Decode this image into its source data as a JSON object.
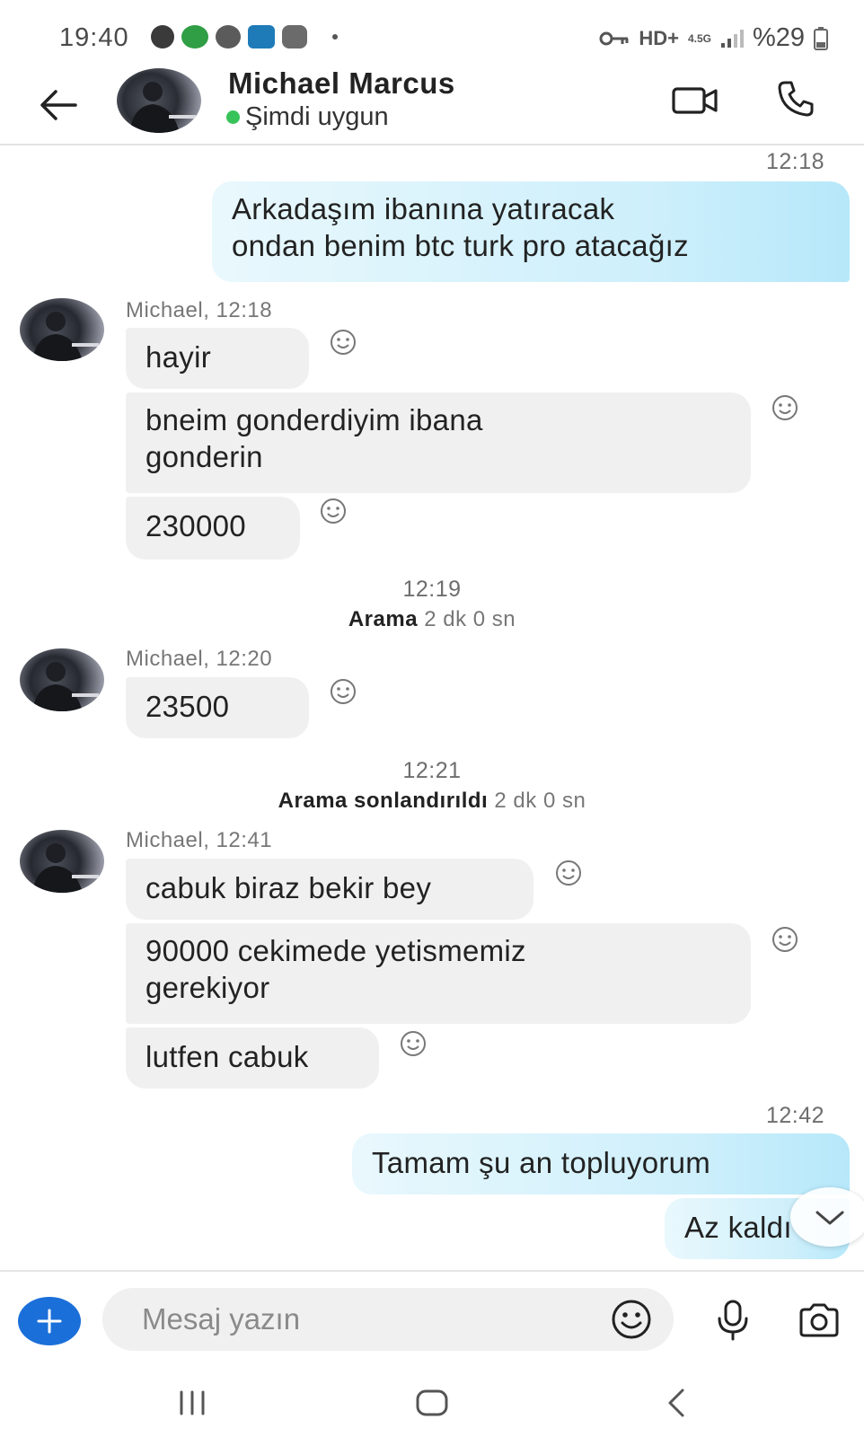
{
  "status_bar": {
    "time": "19:40",
    "network": "HD+",
    "network_gen": "4.5G",
    "battery": "%29"
  },
  "header": {
    "contact_name": "Michael Marcus",
    "presence": "Şimdi uygun"
  },
  "messages": {
    "m1_time": "12:18",
    "m1_text_line1": "Arkadaşım ibanına yatıracak",
    "m1_text_line2": "ondan benim btc turk pro atacağız",
    "g1_sender": "Michael, 12:18",
    "g1_b1": "hayir",
    "g1_b2_line1": "bneim gonderdiyim ibana",
    "g1_b2_line2": "gonderin",
    "g1_b3": "230000",
    "sys1_time": "12:19",
    "sys1_label": "Arama",
    "sys1_duration": "2 dk 0 sn",
    "g2_sender": "Michael, 12:20",
    "g2_b1": "23500",
    "sys2_time": "12:21",
    "sys2_label": "Arama sonlandırıldı",
    "sys2_duration": "2 dk 0 sn",
    "g3_sender": "Michael, 12:41",
    "g3_b1": "cabuk biraz bekir bey",
    "g3_b2_line1": "90000 cekimede yetismemiz",
    "g3_b2_line2": "gerekiyor",
    "g3_b3": "lutfen cabuk",
    "m2_time": "12:42",
    "m2_text": "Tamam şu an topluyorum",
    "m3_text": "Az kaldı"
  },
  "compose": {
    "placeholder": "Mesaj yazın"
  },
  "colors": {
    "outgoing_bubble": "#cdeffb",
    "incoming_bubble": "#f0f0f0",
    "accent": "#1b6fd9",
    "online": "#38c35a"
  },
  "icons": [
    "back-arrow-icon",
    "video-call-icon",
    "phone-icon",
    "smiley-react-icon",
    "plus-icon",
    "emoji-icon",
    "microphone-icon",
    "camera-icon",
    "chevron-down-icon"
  ]
}
